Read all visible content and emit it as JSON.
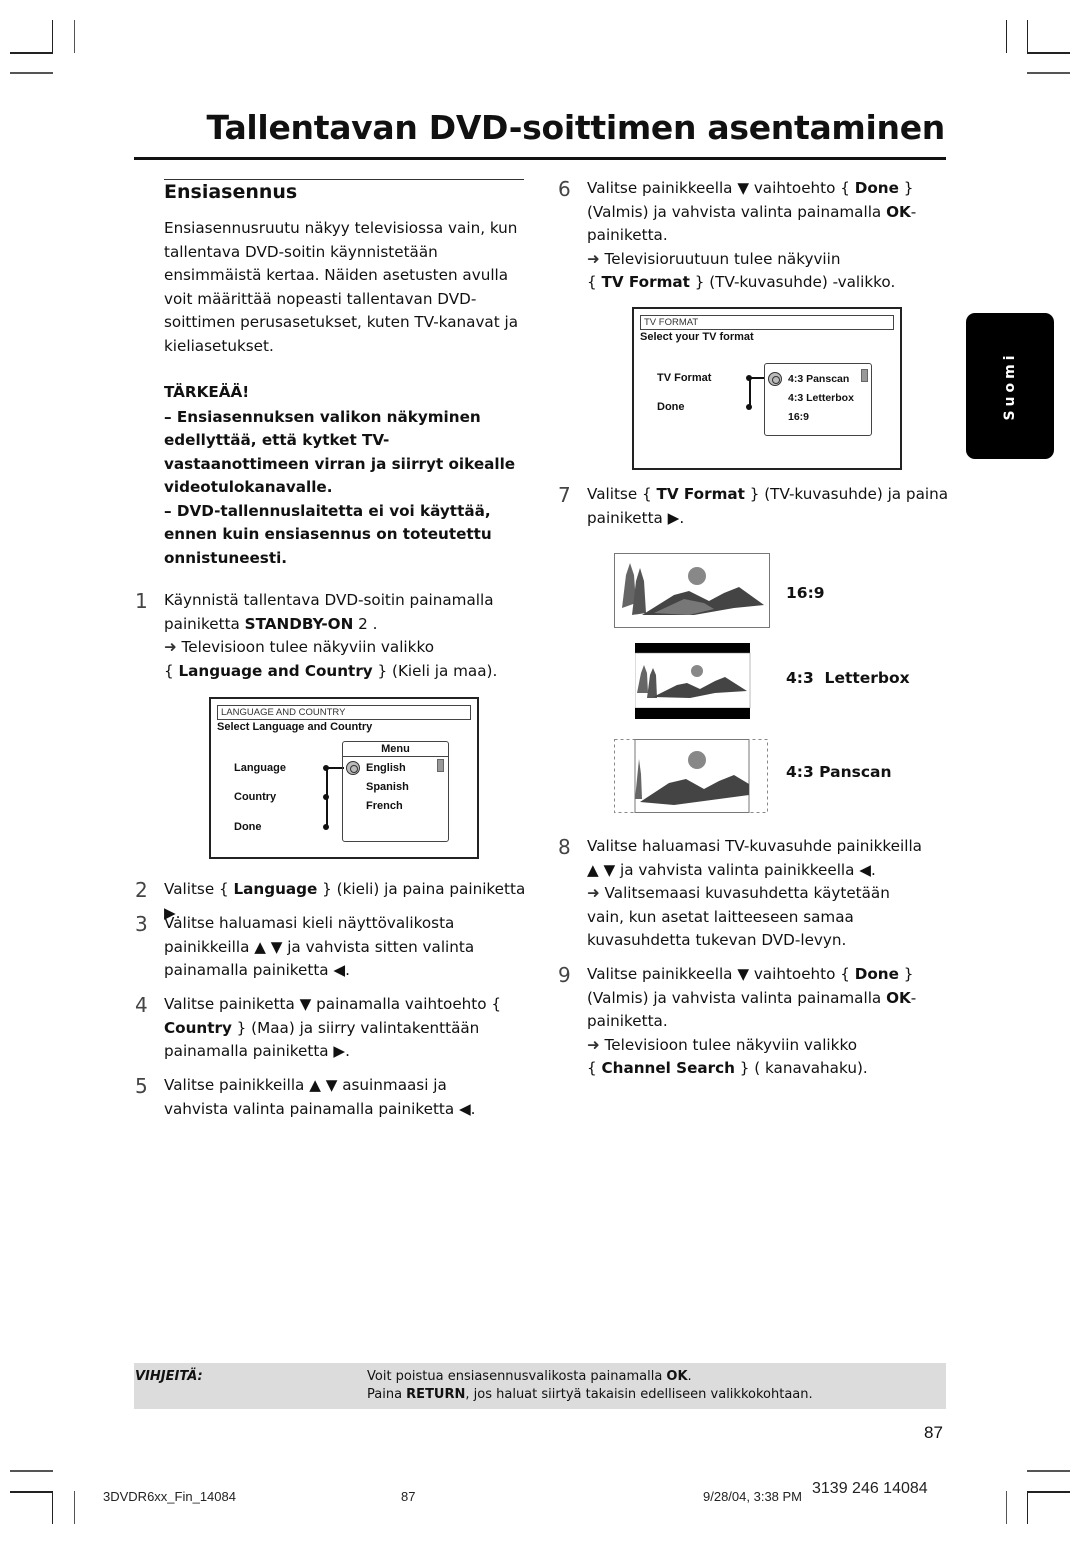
{
  "header": {
    "title": "Tallentavan DVD-soittimen asentaminen"
  },
  "section": {
    "title": "Ensiasennus",
    "intro": "Ensiasennusruutu näkyy televisiossa vain, kun tallentava DVD-soitin käynnistetään ensimmäistä kertaa. Näiden asetusten avulla voit määrittää nopeasti tallentavan DVD-soittimen perusasetukset, kuten TV-kanavat ja kieliasetukset.",
    "important_label": "TÄRKEÄÄ!",
    "important_items": [
      "–  Ensiasennuksen valikon näkyminen edellyttää, että kytket TV-vastaanottimeen virran ja siirryt oikealle videotulokanavalle.",
      "–  DVD-tallennuslaitetta ei voi käyttää, ennen kuin ensiasennus on toteutettu onnistuneesti."
    ]
  },
  "steps": {
    "s1": {
      "num": "1",
      "a": "Käynnistä tallentava DVD-soitin painamalla painiketta ",
      "b": "STANDBY-ON",
      "c": " 2   .",
      "arrow": "➜",
      "d": " Televisioon tulee näkyviin valikko",
      "e": "{ ",
      "f": "Language and Country",
      "g": " } (Kieli ja maa)."
    },
    "s2": {
      "num": "2",
      "a": "Valitse { ",
      "b": "Language",
      "c": " } (kieli) ja paina painiketta ▶."
    },
    "s3": {
      "num": "3",
      "a": "Valitse haluamasi kieli näyttövalikosta painikkeilla ▲ ▼ ja vahvista sitten valinta painamalla painiketta ◀."
    },
    "s4": {
      "num": "4",
      "a": "Valitse painiketta ▼ painamalla vaihtoehto { ",
      "b": "Country",
      "c": " } (Maa) ja siirry valintakenttään painamalla painiketta ▶."
    },
    "s5": {
      "num": "5",
      "a": "Valitse painikkeilla ▲ ▼ asuinmaasi ja vahvista valinta painamalla painiketta ◀."
    },
    "s6": {
      "num": "6",
      "a": "Valitse painikkeella ▼ vaihtoehto { ",
      "b": "Done",
      "c": " } (Valmis) ja vahvista valinta painamalla ",
      "d": "OK",
      "e": "-painiketta.",
      "arrow": "➜",
      "f": " Televisioruutuun tulee näkyviin",
      "g": "{ ",
      "h": "TV Format",
      "i": " } (TV-kuvasuhde) -valikko."
    },
    "s7": {
      "num": "7",
      "a": "Valitse { ",
      "b": "TV Format",
      "c": " } (TV-kuvasuhde) ja paina painiketta ▶."
    },
    "s8": {
      "num": "8",
      "a": "Valitse haluamasi TV-kuvasuhde painikkeilla ▲ ▼ ja vahvista valinta painikkeella ◀.",
      "arrow": "➜",
      "b": " Valitsemaasi kuvasuhdetta käytetään vain, kun asetat laitteeseen samaa kuvasuhdetta tukevan DVD-levyn."
    },
    "s9": {
      "num": "9",
      "a": "Valitse painikkeella ▼ vaihtoehto { ",
      "b": "Done",
      "c": " } (Valmis) ja vahvista valinta painamalla ",
      "d": "OK",
      "e": "-painiketta.",
      "arrow": "➜",
      "f": " Televisioon tulee näkyviin valikko",
      "g": "{ ",
      "h": "Channel Search",
      "i": " } ( kanavahaku)."
    }
  },
  "lang_menu": {
    "header": "LANGUAGE AND COUNTRY",
    "subtitle": "Select Language and Country",
    "items": [
      "Language",
      "Country",
      "Done"
    ],
    "list_title": "Menu",
    "options": [
      "English",
      "Spanish",
      "French"
    ],
    "selected": "English"
  },
  "tv_menu": {
    "header": "TV FORMAT",
    "subtitle": "Select your TV format",
    "items": [
      "TV Format",
      "Done"
    ],
    "options": [
      "4:3 Panscan",
      "4:3 Letterbox",
      "16:9"
    ],
    "selected": "4:3 Panscan"
  },
  "formats": [
    {
      "label": "16:9",
      "icon": "landscape-widescreen-icon"
    },
    {
      "label": "4:3  Letterbox",
      "icon": "landscape-letterbox-icon"
    },
    {
      "label": "4:3 Panscan",
      "icon": "landscape-panscan-icon"
    }
  ],
  "side_tab": {
    "label": "Suomi"
  },
  "tips": {
    "label": "VIHJEITÄ:",
    "line1_a": "Voit poistua ensiasennusvalikosta painamalla ",
    "line1_b": "OK",
    "line1_c": ".",
    "line2_a": "Paina ",
    "line2_b": "RETURN",
    "line2_c": ", jos haluat siirtyä takaisin edelliseen valikkokohtaan."
  },
  "page_number": "87",
  "footer": {
    "file": "3DVDR6xx_Fin_14084",
    "page": "87",
    "date": "9/28/04, 3:38 PM",
    "code": "3139 246 14084"
  }
}
